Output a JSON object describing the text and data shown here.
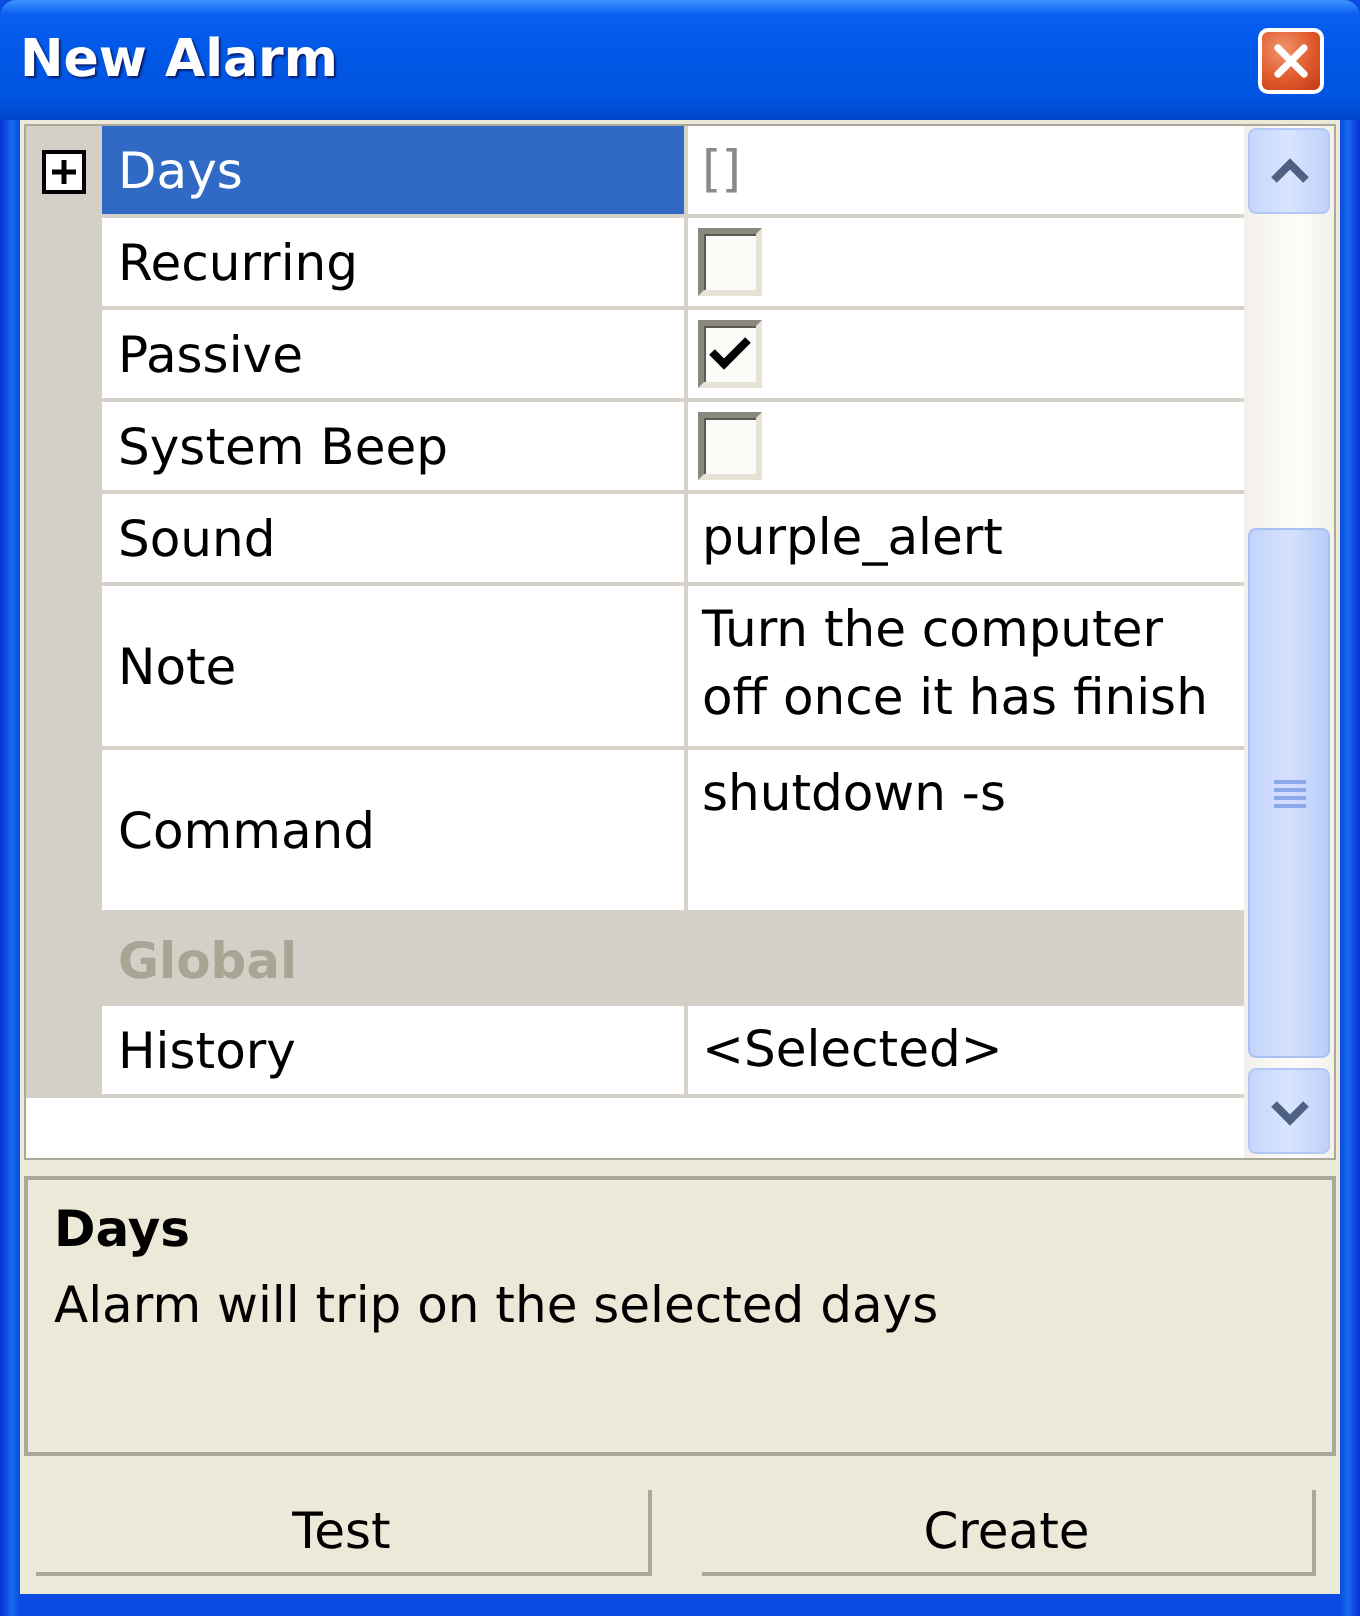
{
  "window": {
    "title": "New Alarm"
  },
  "property_grid": {
    "rows": [
      {
        "kind": "expandable",
        "name": "Days",
        "value": "[]",
        "selected": true,
        "expanded": false
      },
      {
        "kind": "checkbox",
        "name": "Recurring",
        "checked": false,
        "selected": false
      },
      {
        "kind": "checkbox",
        "name": "Passive",
        "checked": true,
        "selected": false
      },
      {
        "kind": "checkbox",
        "name": "System Beep",
        "checked": false,
        "selected": false
      },
      {
        "kind": "text",
        "name": "Sound",
        "value": "purple_alert",
        "selected": false
      },
      {
        "kind": "multiline",
        "name": "Note",
        "value": "Turn the computer off once it has finish",
        "selected": false
      },
      {
        "kind": "multiline",
        "name": "Command",
        "value": "shutdown -s",
        "selected": false
      },
      {
        "kind": "category",
        "name": "Global",
        "selected": false
      },
      {
        "kind": "text",
        "name": "History",
        "value": "<Selected>",
        "selected": false
      }
    ]
  },
  "description": {
    "title": "Days",
    "text": "Alarm will trip on the selected days"
  },
  "buttons": [
    "Test",
    "Create"
  ]
}
